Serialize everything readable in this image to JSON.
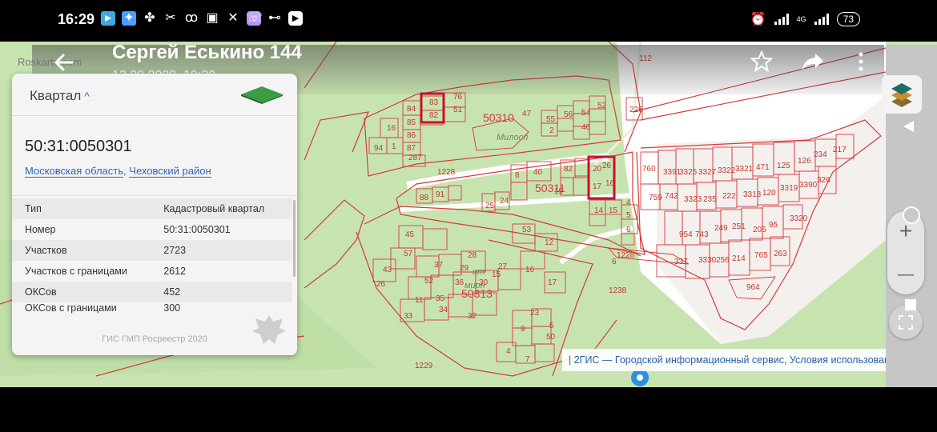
{
  "status_bar": {
    "time": "16:29",
    "network": "4G",
    "battery": "73",
    "icons": [
      "navigation-app-icon",
      "photos-icon",
      "fan-icon",
      "broom-icon",
      "odnoklassniki-icon",
      "save-icon",
      "tools-icon",
      "viber-icon",
      "car-icon",
      "youtube-icon"
    ]
  },
  "viewer": {
    "title": "Сергей Еськино 144",
    "subtitle": "12.09.2020, 19:29",
    "watermark": "Roskarta.com"
  },
  "panel": {
    "header": "Квартал",
    "header_chevron": "^",
    "number": "50:31:0050301",
    "region_link": "Московская область",
    "separator": ",",
    "district_link": "Чеховский район",
    "rows": [
      {
        "label": "Тип",
        "value": "Кадастровый квартал"
      },
      {
        "label": "Номер",
        "value": "50:31:0050301"
      },
      {
        "label": "Участков",
        "value": "2723"
      },
      {
        "label": "Участков с границами",
        "value": "2612"
      },
      {
        "label": "ОКСов",
        "value": "452"
      },
      {
        "label": "ОКСов с границами",
        "value": "300"
      }
    ],
    "footer": "ГИС ГМП Росреестр 2020"
  },
  "map": {
    "attribution": "| 2ГИС — Городской информационный сервис, Условия использования",
    "zoom_in_label": "+",
    "zoom_out_label": "—",
    "quarter_labels": [
      "50310",
      "50311",
      "50313"
    ],
    "place_labels": [
      "Милосл",
      "ит",
      "мирн"
    ],
    "parcel_numbers": [
      "112",
      "84",
      "83",
      "76",
      "85",
      "82",
      "51",
      "86",
      "16",
      "94",
      "1",
      "87",
      "287",
      "52",
      "54",
      "46",
      "56",
      "55",
      "2",
      "47",
      "226",
      "1228",
      "40",
      "82",
      "88",
      "91",
      "8",
      "26",
      "20",
      "16",
      "17",
      "19",
      "25",
      "24",
      "14",
      "15",
      "760",
      "3391",
      "3325",
      "3327",
      "3322",
      "3321",
      "471",
      "125",
      "126",
      "234",
      "217",
      "759",
      "742",
      "3323",
      "235",
      "222",
      "3318",
      "120",
      "3319",
      "3390",
      "326",
      "1228",
      "45",
      "57",
      "53",
      "12",
      "43",
      "37",
      "29",
      "28",
      "15",
      "26",
      "52",
      "36",
      "30",
      "27",
      "16",
      "17",
      "11",
      "35",
      "33",
      "34",
      "32",
      "23",
      "9",
      "50",
      "5",
      "4",
      "7",
      "6",
      "1238",
      "1229",
      "954",
      "743",
      "249",
      "251",
      "205",
      "95",
      "3320",
      "337",
      "3330",
      "256",
      "214",
      "765",
      "263",
      "964",
      "6",
      "5",
      "4"
    ],
    "colors": {
      "parcel_border": "#d43b3b",
      "selected_border": "#c8102e",
      "map_green": "#c7e4b0",
      "map_road": "#ffffff"
    }
  }
}
